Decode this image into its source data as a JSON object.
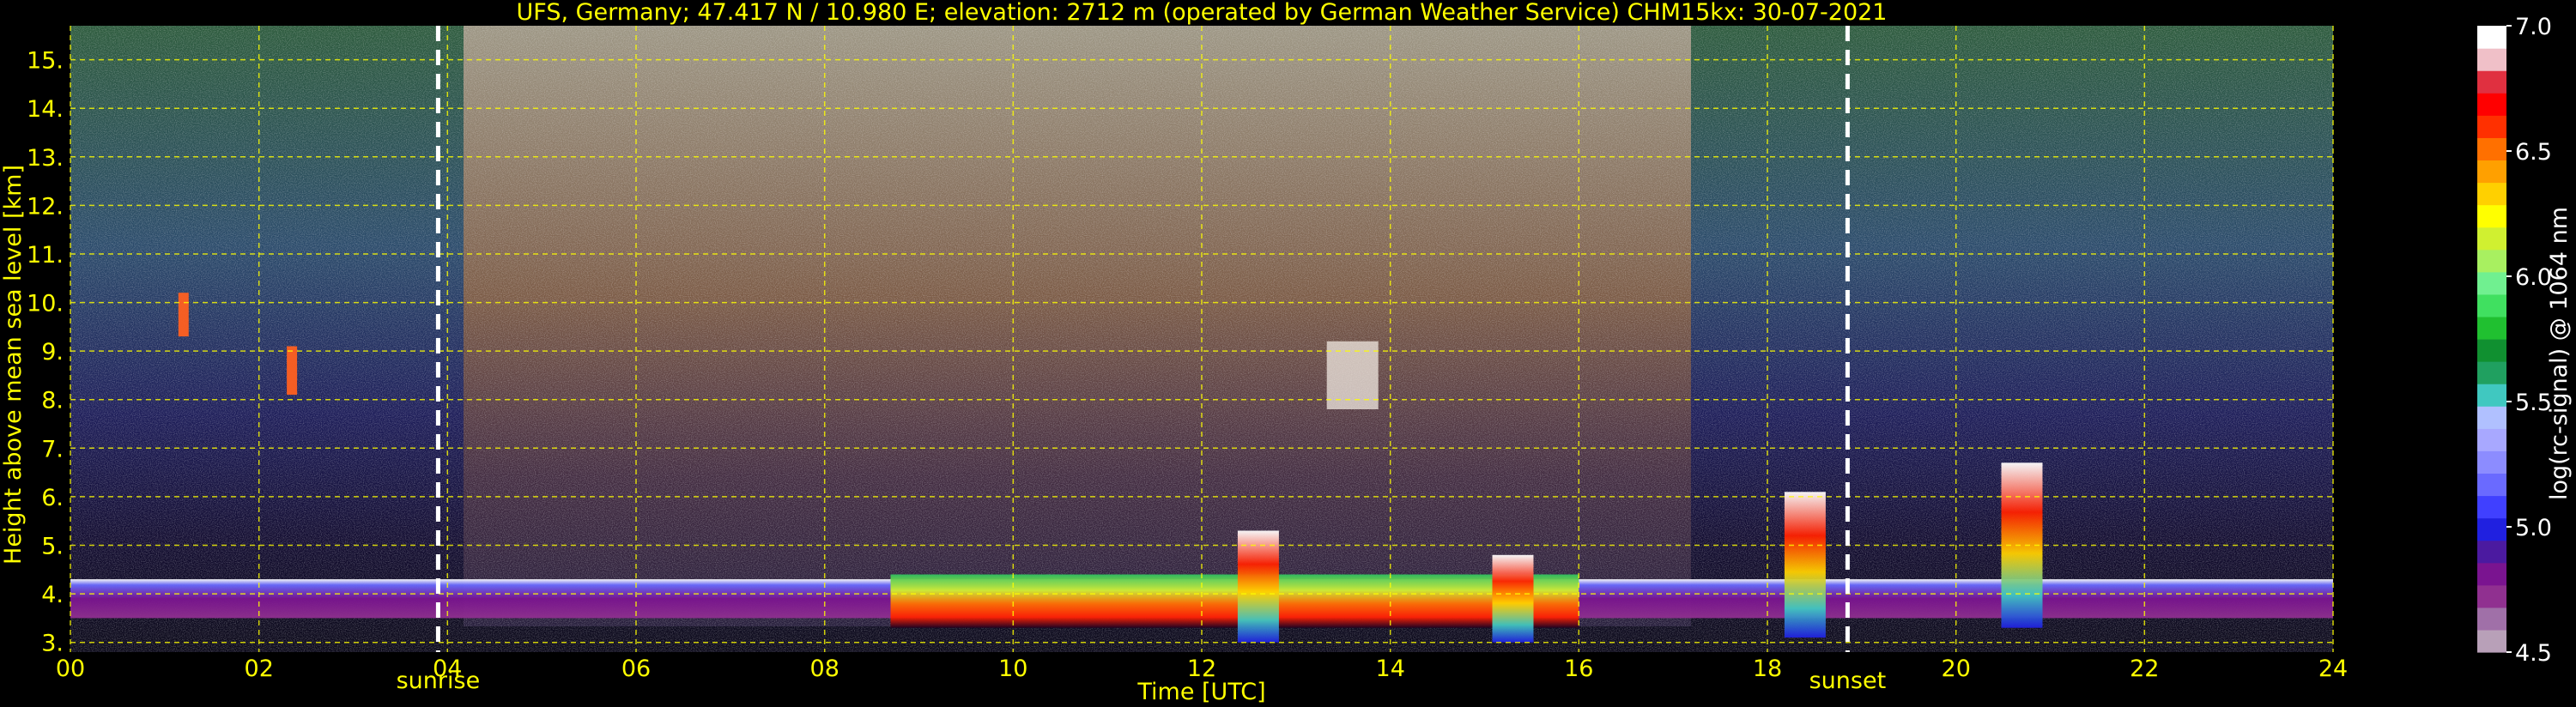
{
  "chart_data": {
    "type": "heatmap",
    "title": "UFS, Germany; 47.417 N / 10.980 E; elevation: 2712 m  (operated by German Weather Service)    CHM15kx: 30-07-2021",
    "xlabel": "Time [UTC]",
    "ylabel": "Height above mean sea level [km]",
    "x_range_hours": [
      0,
      24
    ],
    "y_range_km": [
      2.8,
      15.7
    ],
    "x_ticks": [
      "00",
      "02",
      "04",
      "06",
      "08",
      "10",
      "12",
      "14",
      "16",
      "18",
      "20",
      "22",
      "24"
    ],
    "y_ticks": [
      "3.",
      "4.",
      "5.",
      "6.",
      "7.",
      "8.",
      "9.",
      "10.",
      "11.",
      "12.",
      "13.",
      "14.",
      "15."
    ],
    "grid": true,
    "grid_color": "#ffff00",
    "axis_text_color": "#ffff00",
    "background": "#000000",
    "markers": [
      {
        "label": "sunrise",
        "time_hours": 3.9
      },
      {
        "label": "sunset",
        "time_hours": 18.85
      }
    ],
    "colorbar": {
      "label": "log(rc-signal) @ 1064 nm",
      "range": [
        4.5,
        7.0
      ],
      "ticks": [
        "4.5",
        "5.0",
        "5.5",
        "6.0",
        "6.5",
        "7.0"
      ],
      "colors": [
        "#b8a0b8",
        "#a070a8",
        "#903090",
        "#7a1490",
        "#4b1aa0",
        "#2020e0",
        "#4040ff",
        "#6a6aff",
        "#8c8cff",
        "#a8a8ff",
        "#b0c0ff",
        "#40c8c0",
        "#20a060",
        "#109030",
        "#20c030",
        "#40e060",
        "#70f090",
        "#a8f060",
        "#d0f030",
        "#ffff00",
        "#ffd000",
        "#ffa000",
        "#ff7000",
        "#ff3000",
        "#ff0000",
        "#e03040",
        "#f0c0c8",
        "#ffffff"
      ]
    },
    "features": [
      {
        "kind": "boundary_layer_top",
        "time_start": 0,
        "time_end": 24,
        "height_km": [
          3.5,
          4.3
        ]
      },
      {
        "kind": "high_signal_band",
        "time_start": 8.7,
        "time_end": 16.0,
        "height_km": [
          3.3,
          4.4
        ]
      },
      {
        "kind": "cloud",
        "time_hours": 12.6,
        "height_km": [
          3.0,
          5.3
        ]
      },
      {
        "kind": "cloud",
        "time_hours": 15.3,
        "height_km": [
          3.0,
          4.8
        ]
      },
      {
        "kind": "cloud",
        "time_hours": 18.4,
        "height_km": [
          3.1,
          6.1
        ]
      },
      {
        "kind": "cloud",
        "time_hours": 20.7,
        "height_km": [
          3.3,
          6.7
        ]
      },
      {
        "kind": "cirrus",
        "time_hours": 13.6,
        "height_km": [
          7.8,
          9.2
        ]
      },
      {
        "kind": "elevated_layer",
        "time_hours": 1.2,
        "height_km": [
          9.3,
          10.2
        ]
      },
      {
        "kind": "elevated_layer",
        "time_hours": 2.35,
        "height_km": [
          8.1,
          9.1
        ]
      }
    ]
  }
}
